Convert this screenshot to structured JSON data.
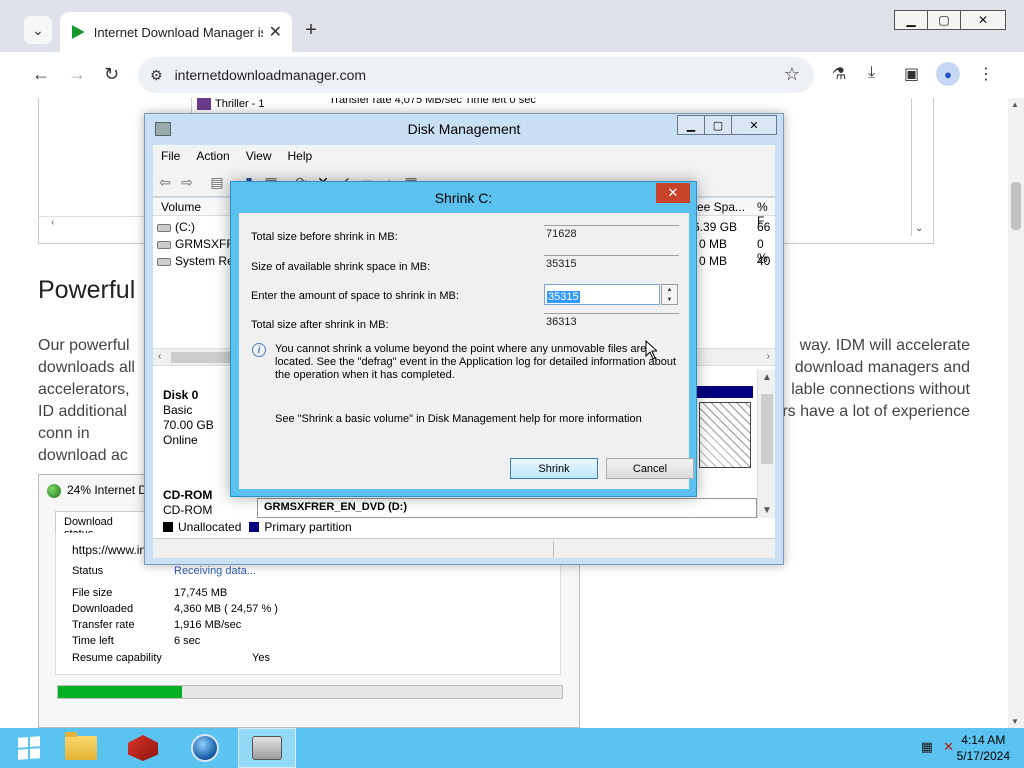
{
  "browser": {
    "tab_title": "Internet Download Manager is",
    "url": "internetdownloadmanager.com",
    "tab_menu_icon": "chevron-down-icon",
    "new_tab_symbol": "+"
  },
  "page": {
    "heading": "Powerful",
    "para_left": "Our powerful downloads all accelerators, ID additional conn in download ac",
    "para_right": "way. IDM will accelerate download managers and lable connections without rs have a lot of experience",
    "thriller_label": "Thriller - 1",
    "cut_text": "Transfer rate   4,075  MB/sec   Time left  0 sec"
  },
  "idm": {
    "title": "24% Internet D",
    "tab": "Download status",
    "url": "https://www.in",
    "rows": [
      {
        "label": "Status",
        "value": "Receiving data..."
      },
      {
        "label": "File size",
        "value": "17,745  MB"
      },
      {
        "label": "Downloaded",
        "value": "4,360  MB  ( 24,57 % )"
      },
      {
        "label": "Transfer rate",
        "value": "1,916  MB/sec"
      },
      {
        "label": "Time left",
        "value": "6 sec"
      },
      {
        "label": "Resume capability",
        "value": "Yes"
      }
    ],
    "progress": 0.2457
  },
  "disk_mgmt": {
    "title": "Disk Management",
    "menu": [
      "File",
      "Action",
      "View",
      "Help"
    ],
    "columns": {
      "volume": "Volume",
      "free_space": "ree Spa...",
      "pct": "% F"
    },
    "volumes": [
      {
        "name": "(C:)",
        "free": "6.39 GB",
        "pct": "66"
      },
      {
        "name": "GRMSXFRE",
        "free": "0 MB",
        "pct": "0 %"
      },
      {
        "name": "System Res",
        "free": "0 MB",
        "pct": "40"
      }
    ],
    "disk0": {
      "name": "Disk 0",
      "type": "Basic",
      "size": "70.00 GB",
      "status": "Online"
    },
    "cdrom": {
      "name": "CD-ROM",
      "type": "CD-ROM",
      "volume_label": "GRMSXFRER_EN_DVD (D:)"
    },
    "legend": {
      "unallocated": "Unallocated",
      "primary": "Primary partition"
    }
  },
  "shrink": {
    "title": "Shrink C:",
    "total_before_label": "Total size before shrink in MB:",
    "total_before": "71628",
    "available_label": "Size of available shrink space in MB:",
    "available": "35315",
    "amount_label": "Enter the amount of space to shrink in MB:",
    "amount": "35315",
    "after_label": "Total size after shrink in MB:",
    "after": "36313",
    "info": "You cannot shrink a volume beyond the point where any unmovable files are located. See the \"defrag\" event in the Application log for detailed information about the operation when it has completed.",
    "help": "See \"Shrink a basic volume\" in Disk Management help for more information",
    "shrink_btn": "Shrink",
    "cancel_btn": "Cancel"
  },
  "taskbar": {
    "time": "4:14 AM",
    "date": "5/17/2024"
  }
}
